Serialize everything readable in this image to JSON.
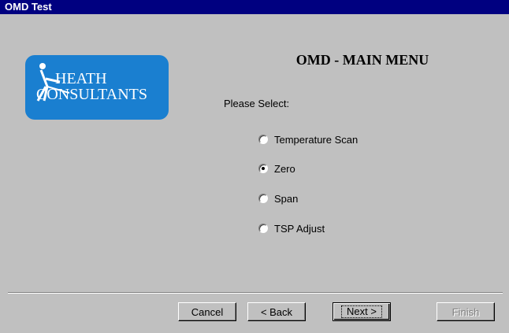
{
  "window": {
    "title": "OMD Test"
  },
  "logo": {
    "line1": "HEATH",
    "line2": "CONSULTANTS",
    "color": "#1a7fd0"
  },
  "main": {
    "title": "OMD - MAIN MENU",
    "prompt": "Please Select:",
    "options": [
      {
        "label": "Temperature Scan",
        "selected": false
      },
      {
        "label": "Zero",
        "selected": true
      },
      {
        "label": "Span",
        "selected": false
      },
      {
        "label": "TSP Adjust",
        "selected": false
      }
    ]
  },
  "buttons": {
    "cancel": "Cancel",
    "back": "< Back",
    "next": "Next >",
    "finish": "Finish"
  }
}
